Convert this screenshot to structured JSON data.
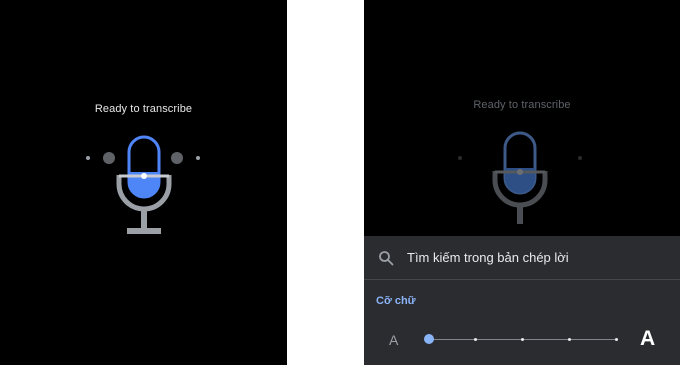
{
  "left_screen": {
    "status_text": "Ready to transcribe",
    "mic_icon": "microphone-icon",
    "colors": {
      "accent": "#4f86f7",
      "mic_stand": "#9aa0a6",
      "background": "#000000"
    }
  },
  "right_screen": {
    "status_text": "Ready to transcribe",
    "mic_icon": "microphone-icon",
    "sheet": {
      "search": {
        "icon": "search-icon",
        "label": "Tìm kiếm trong bản chép lời"
      },
      "font_size_section": {
        "label": "Cỡ chữ",
        "small_label": "A",
        "large_label": "A",
        "slider": {
          "stops": 5,
          "selected_index": 0
        }
      }
    },
    "colors": {
      "sheet_bg": "#2b2c2f",
      "section_accent": "#8ab4f8"
    }
  }
}
